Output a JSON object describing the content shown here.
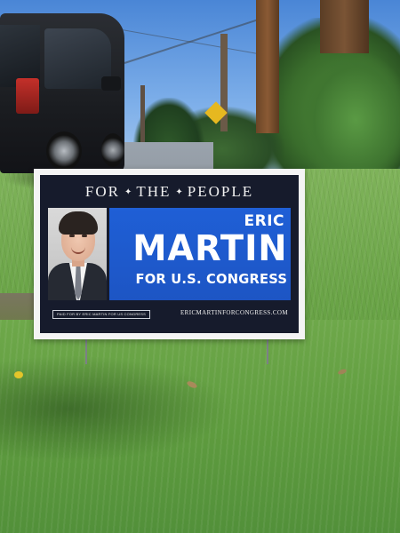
{
  "scene": {
    "description_colors": {
      "sky": "#4a86d6",
      "grass": "#6aa447",
      "sign_blue": "#1f5fd6",
      "sign_navy": "#161b2c"
    }
  },
  "sign": {
    "slogan_words": [
      "FOR",
      "THE",
      "PEOPLE"
    ],
    "slogan_separator": "✦",
    "first_name": "ERIC",
    "last_name": "MARTIN",
    "office": "FOR U.S. CONGRESS",
    "disclaimer": "PAID FOR BY ERIC MARTIN FOR US CONGRESS",
    "website": "ERICMARTINFORCONGRESS.COM"
  }
}
